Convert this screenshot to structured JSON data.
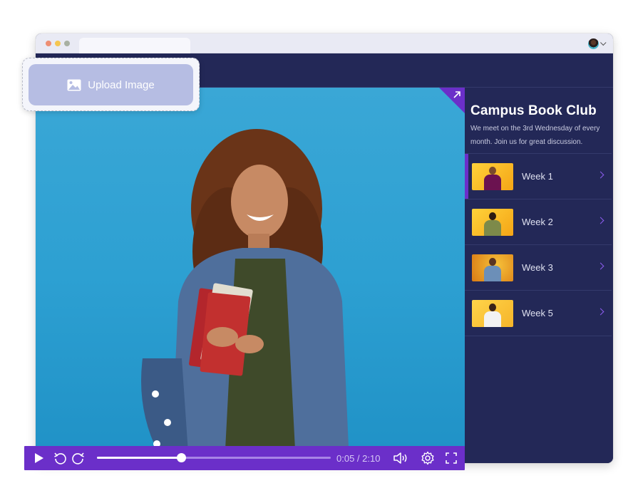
{
  "browser": {
    "tab_title": "",
    "account_menu": "account-avatar"
  },
  "upload": {
    "label": "Upload Image",
    "icon": "image-icon"
  },
  "sidebar": {
    "title": "Campus Book Club",
    "description": "We meet on the 3rd Wednesday of every month. Join us for great discussion.",
    "items": [
      {
        "label": "Week 1",
        "active": true,
        "shirt": "#6b1250"
      },
      {
        "label": "Week 2",
        "active": false,
        "shirt": "#7d8a4a"
      },
      {
        "label": "Week 3",
        "active": false,
        "shirt": "#6c8fb8"
      },
      {
        "label": "Week 5",
        "active": false,
        "shirt": "#f2f2f2"
      }
    ]
  },
  "player": {
    "current_time": "0:05",
    "duration": "2:10",
    "time_display": "0:05 / 2:10",
    "progress_fraction": 0.36,
    "icons": [
      "play-icon",
      "rewind-icon",
      "forward-icon",
      "volume-icon",
      "settings-icon",
      "fullscreen-icon"
    ]
  },
  "colors": {
    "accent": "#6b2fc9",
    "panel": "#232857",
    "video_bg": "#2da0d2",
    "upload_button": "#b6bde3"
  }
}
